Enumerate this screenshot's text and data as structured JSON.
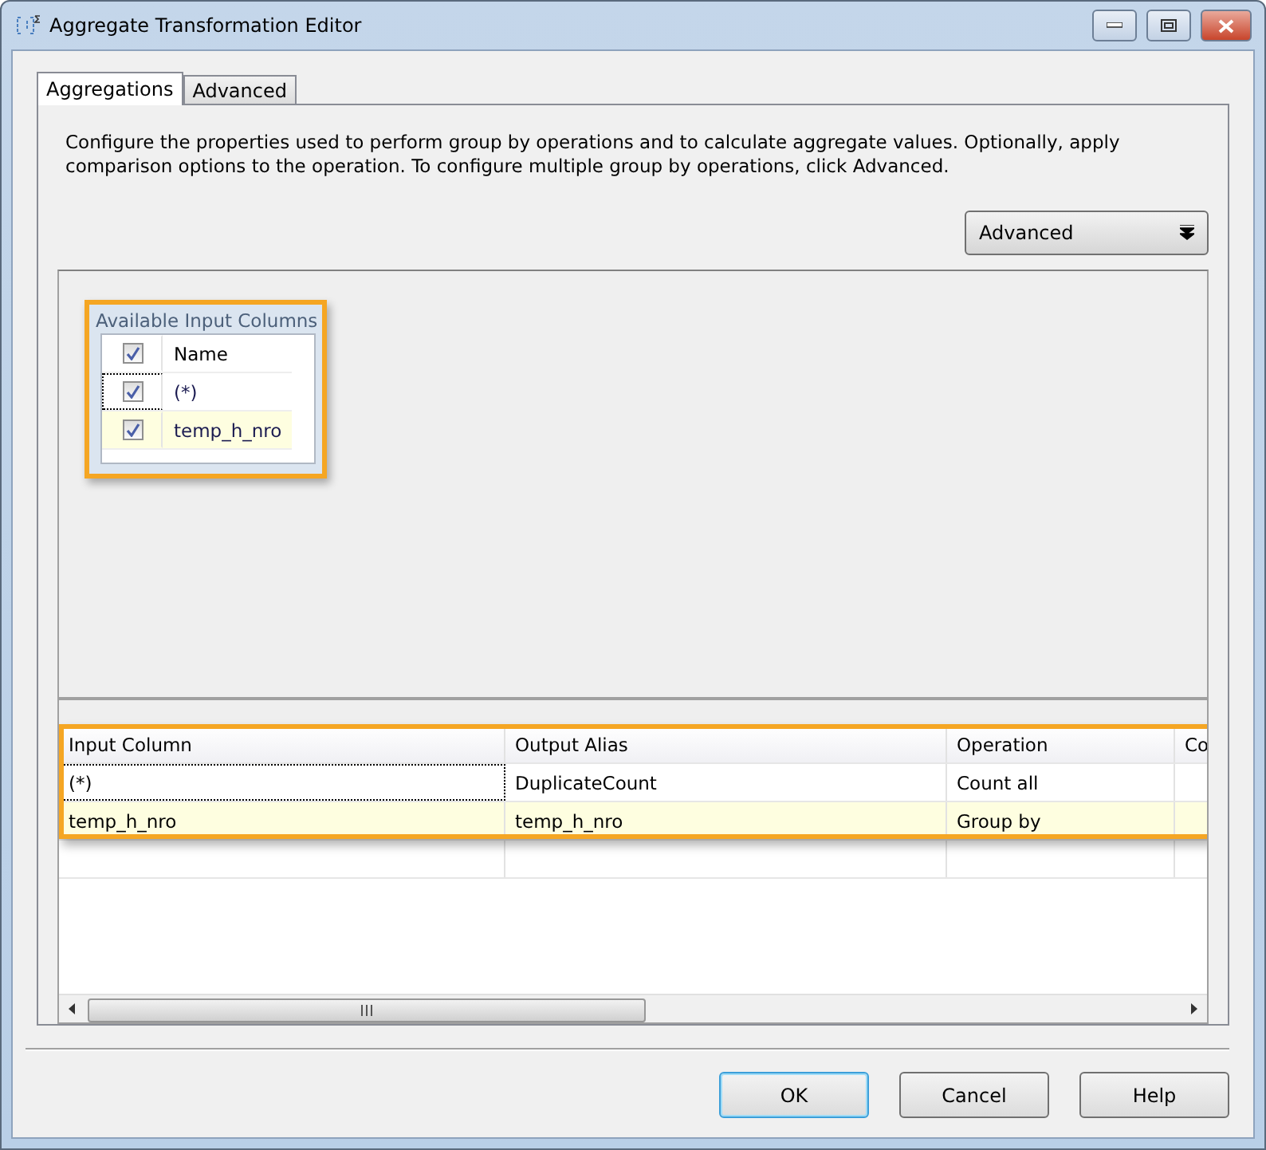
{
  "window": {
    "title": "Aggregate Transformation Editor"
  },
  "tabs": [
    {
      "label": "Aggregations",
      "selected": true
    },
    {
      "label": "Advanced",
      "selected": false
    }
  ],
  "description": "Configure the properties used to perform group by operations and to calculate aggregate values. Optionally, apply comparison options to the operation. To configure multiple group by operations, click Advanced.",
  "advanced_button": {
    "label": "Advanced"
  },
  "available_columns": {
    "title": "Available Input Columns",
    "header": {
      "label": "Name",
      "checked": true
    },
    "items": [
      {
        "label": "(*)",
        "checked": true,
        "selected": false,
        "focused": true
      },
      {
        "label": "temp_h_nro",
        "checked": true,
        "selected": true,
        "focused": false
      }
    ]
  },
  "grid": {
    "columns": [
      "Input Column",
      "Output Alias",
      "Operation",
      "Co"
    ],
    "rows": [
      {
        "cells": [
          "(*)",
          "DuplicateCount",
          "Count all",
          ""
        ],
        "selected": false,
        "focused": true
      },
      {
        "cells": [
          "temp_h_nro",
          "temp_h_nro",
          "Group by",
          ""
        ],
        "selected": true,
        "focused": false
      }
    ]
  },
  "buttons": [
    {
      "label": "OK",
      "default": true
    },
    {
      "label": "Cancel",
      "default": false
    },
    {
      "label": "Help",
      "default": false
    }
  ]
}
